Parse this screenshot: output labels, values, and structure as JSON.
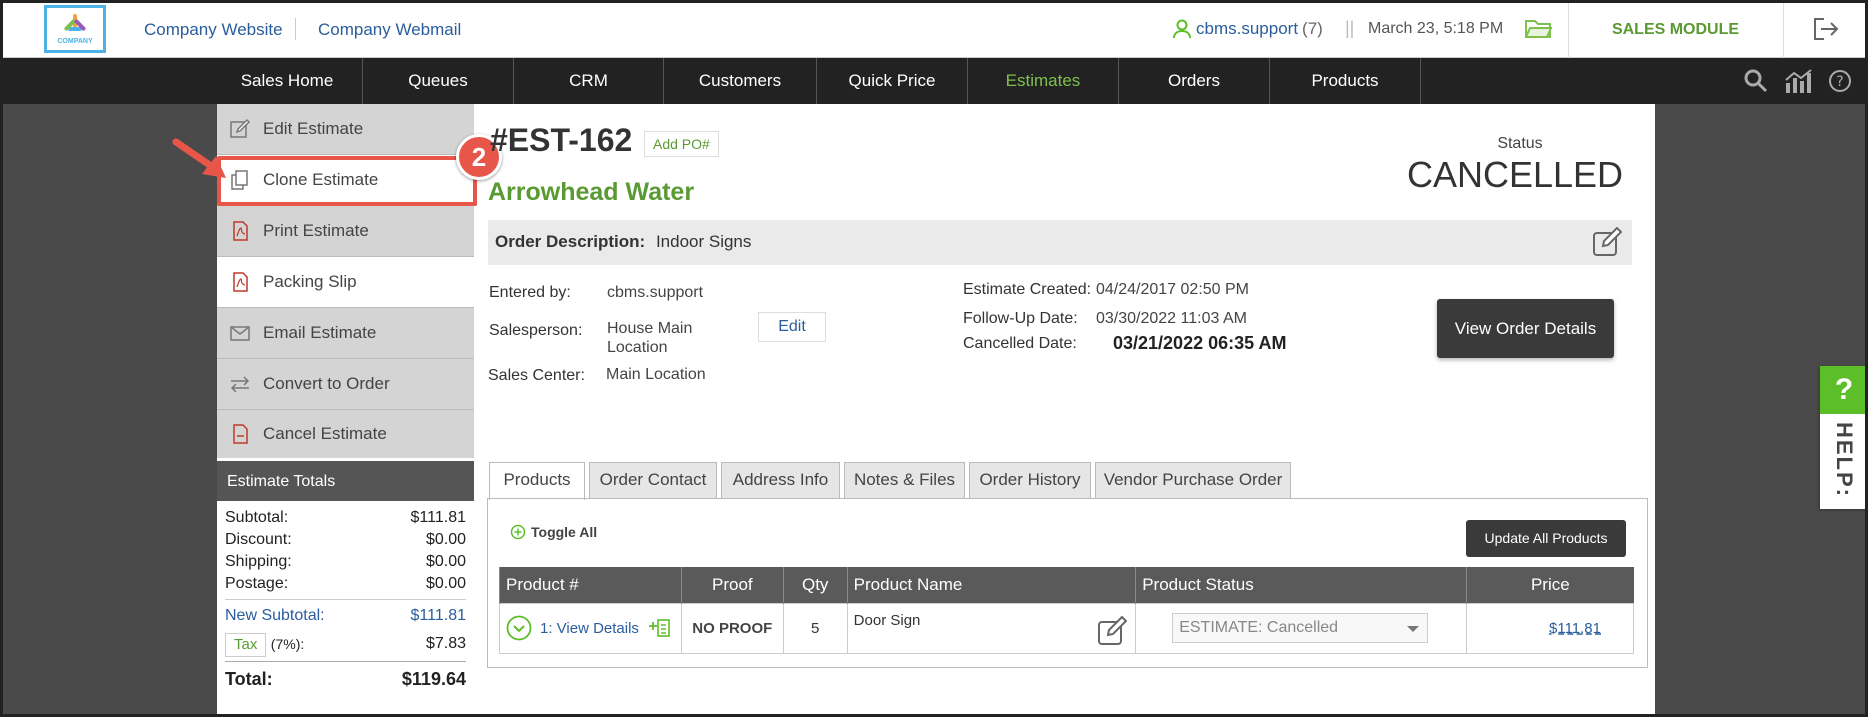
{
  "header": {
    "logo_text": "COMPANY",
    "links": [
      "Company Website",
      "Company Webmail"
    ],
    "user": "cbms.support",
    "user_count": "(7)",
    "datetime": "March 23, 5:18 PM",
    "module": "SALES MODULE"
  },
  "nav": {
    "items": [
      "Sales Home",
      "Queues",
      "CRM",
      "Customers",
      "Quick Price",
      "Estimates",
      "Orders",
      "Products"
    ],
    "active": "Estimates"
  },
  "sidebar": {
    "actions": [
      "Edit Estimate",
      "Clone Estimate",
      "Print Estimate",
      "Packing Slip",
      "Email Estimate",
      "Convert to Order",
      "Cancel Estimate"
    ],
    "totals_title": "Estimate Totals",
    "totals": {
      "subtotal_label": "Subtotal:",
      "subtotal": "$111.81",
      "discount_label": "Discount:",
      "discount": "$0.00",
      "shipping_label": "Shipping:",
      "shipping": "$0.00",
      "postage_label": "Postage:",
      "postage": "$0.00",
      "new_subtotal_label": "New Subtotal:",
      "new_subtotal": "$111.81",
      "tax_label": "Tax",
      "tax_rate": "(7%):",
      "tax": "$7.83",
      "total_label": "Total:",
      "total": "$119.64"
    }
  },
  "callout": {
    "step": "2"
  },
  "estimate": {
    "number": "#EST-162",
    "add_po": "Add PO#",
    "customer": "Arrowhead Water",
    "status_label": "Status",
    "status": "CANCELLED",
    "description_label": "Order Description:",
    "description": "Indoor Signs",
    "entered_by_label": "Entered by:",
    "entered_by": "cbms.support",
    "salesperson_label": "Salesperson:",
    "salesperson_line1": "House Main",
    "salesperson_line2": "Location",
    "salesperson_edit": "Edit",
    "sales_center_label": "Sales Center:",
    "sales_center": "Main Location",
    "created_label": "Estimate Created:",
    "created": "04/24/2017 02:50 PM",
    "followup_label": "Follow-Up Date:",
    "followup": "03/30/2022 11:03 AM",
    "cancelled_label": "Cancelled Date:",
    "cancelled": "03/21/2022 06:35 AM",
    "view_order_details": "View Order Details"
  },
  "tabs": [
    "Products",
    "Order Contact",
    "Address Info",
    "Notes & Files",
    "Order History",
    "Vendor Purchase Order"
  ],
  "products": {
    "toggle_all": "Toggle All",
    "update_all": "Update All Products",
    "columns": [
      "Product #",
      "Proof",
      "Qty",
      "Product Name",
      "Product Status",
      "Price"
    ],
    "rows": [
      {
        "num": "1: View Details",
        "proof": "NO PROOF",
        "qty": "5",
        "name": "Door Sign",
        "status": "ESTIMATE: Cancelled",
        "price": "$111.81"
      }
    ]
  },
  "help": {
    "q": "?",
    "label": "HELP:"
  }
}
